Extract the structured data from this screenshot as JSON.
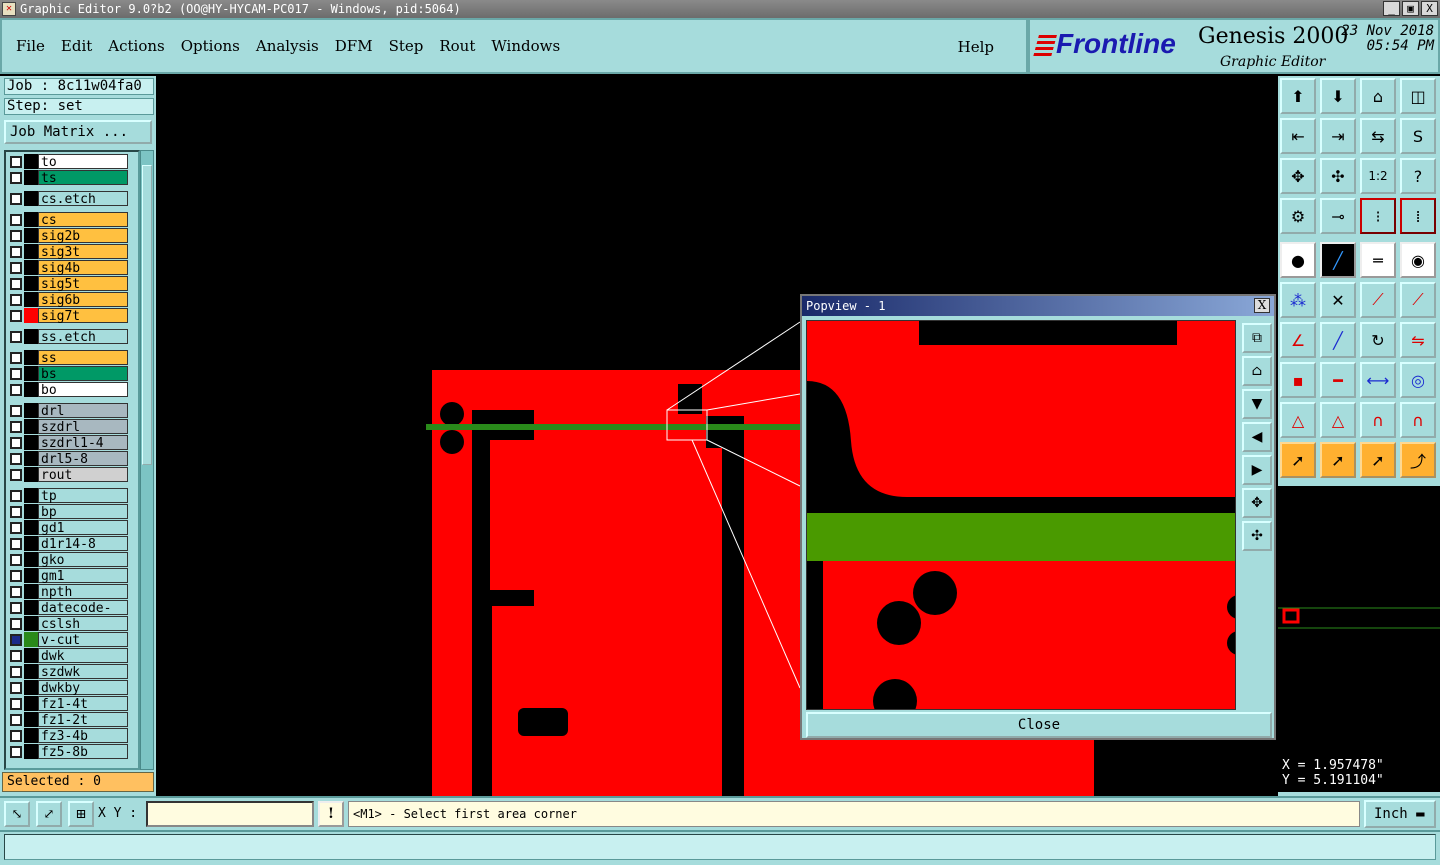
{
  "window": {
    "title": "Graphic Editor 9.0?b2 (OO@HY-HYCAM-PC017 - Windows, pid:5064)",
    "btn_min": "_",
    "btn_max": "▣",
    "btn_close": "X"
  },
  "menu": {
    "items": [
      "File",
      "Edit",
      "Actions",
      "Options",
      "Analysis",
      "DFM",
      "Step",
      "Rout",
      "Windows"
    ],
    "help": "Help"
  },
  "brand": {
    "logo": "Frontline",
    "product": "Genesis 2000",
    "subtitle": "Graphic Editor",
    "date": "23 Nov 2018",
    "time": "05:54 PM"
  },
  "job": {
    "job_label": "Job : 8c11w04fa0",
    "step_label": "Step: set",
    "matrix_button": "Job Matrix ..."
  },
  "layers": [
    {
      "name": "to",
      "color": "#ffffff"
    },
    {
      "name": "ts",
      "color": "#009966"
    },
    {
      "name": "cs.etch",
      "color": "#a6dcdc"
    },
    {
      "name": "cs",
      "color": "#ffc040"
    },
    {
      "name": "sig2b",
      "color": "#ffc040"
    },
    {
      "name": "sig3t",
      "color": "#ffc040"
    },
    {
      "name": "sig4b",
      "color": "#ffc040"
    },
    {
      "name": "sig5t",
      "color": "#ffc040"
    },
    {
      "name": "sig6b",
      "color": "#ffc040"
    },
    {
      "name": "sig7t",
      "color": "#ffc040",
      "swatch": "#ff0000"
    },
    {
      "name": "ss.etch",
      "color": "#a6dcdc"
    },
    {
      "name": "ss",
      "color": "#ffc040"
    },
    {
      "name": "bs",
      "color": "#009966"
    },
    {
      "name": "bo",
      "color": "#ffffff"
    },
    {
      "name": "drl",
      "color": "#a8b8c0"
    },
    {
      "name": "szdrl",
      "color": "#a8b8c0"
    },
    {
      "name": "szdrl1-4",
      "color": "#a8b8c0"
    },
    {
      "name": "drl5-8",
      "color": "#a8b8c0"
    },
    {
      "name": "rout",
      "color": "#d0d0d0"
    },
    {
      "name": "tp",
      "color": "#a6dcdc"
    },
    {
      "name": "bp",
      "color": "#a6dcdc"
    },
    {
      "name": "gd1",
      "color": "#a6dcdc"
    },
    {
      "name": "d1r14-8",
      "color": "#a6dcdc"
    },
    {
      "name": "gko",
      "color": "#a6dcdc"
    },
    {
      "name": "gm1",
      "color": "#a6dcdc"
    },
    {
      "name": "npth",
      "color": "#a6dcdc"
    },
    {
      "name": "datecode-to",
      "color": "#a6dcdc"
    },
    {
      "name": "cslsh",
      "color": "#a6dcdc"
    },
    {
      "name": "v-cut",
      "color": "#a6dcdc",
      "swatch": "#2a8a1a",
      "selected": true
    },
    {
      "name": "dwk",
      "color": "#a6dcdc"
    },
    {
      "name": "szdwk",
      "color": "#a6dcdc"
    },
    {
      "name": "dwkby",
      "color": "#a6dcdc"
    },
    {
      "name": "fz1-4t",
      "color": "#a6dcdc"
    },
    {
      "name": "fz1-2t",
      "color": "#a6dcdc"
    },
    {
      "name": "fz3-4b",
      "color": "#a6dcdc"
    },
    {
      "name": "fz5-8b",
      "color": "#a6dcdc"
    }
  ],
  "selected": "Selected : 0",
  "popview": {
    "title": "Popview - 1",
    "close_label": "Close",
    "close_x": "X"
  },
  "coords": {
    "x": "X = 1.957478\"",
    "y": "Y = 5.191104\""
  },
  "bottom": {
    "xy_label": "X Y :",
    "xy_value": "",
    "warn": "!",
    "message": "<M1> - Select first area corner",
    "unit": "Inch"
  }
}
